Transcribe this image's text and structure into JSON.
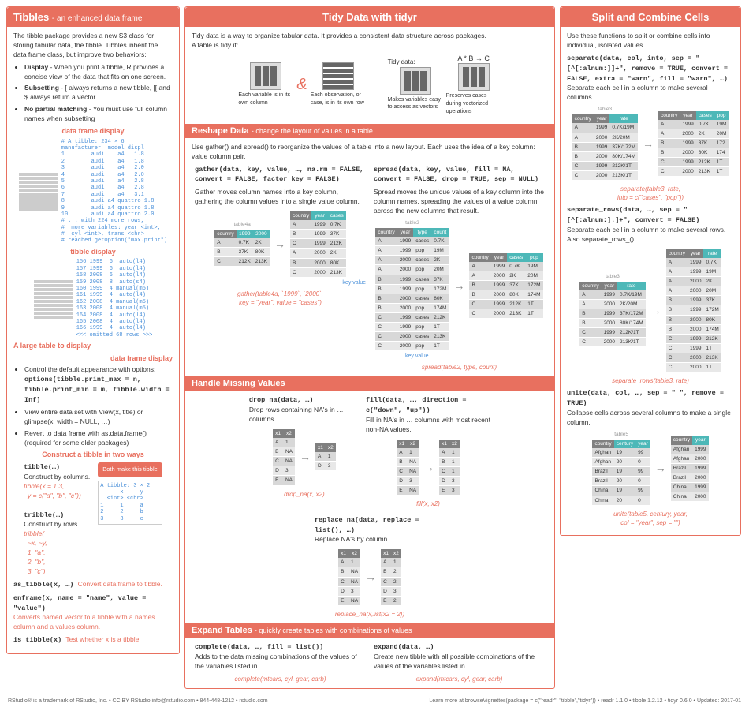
{
  "left": {
    "title": "Tibbles",
    "subtitle": "- an enhanced data frame",
    "intro": "The tibble package provides a new S3 class for storing tabular data, the tibble. Tibbles inherit the data frame class, but improve two behaviors:",
    "bullets": [
      {
        "b": "Display",
        "t": " - When you print a tibble, R provides a concise view of the data that fits on one screen."
      },
      {
        "b": "Subsetting",
        "t": " - [ always returns a new tibble, [[ and $ always return a vector."
      },
      {
        "b": "No partial matching",
        "t": " - You must use full column names when subsetting"
      }
    ],
    "dflabel": "data frame display",
    "tiblabel": "tibble display",
    "largelbl": "A large table\nto display",
    "control": "Control the default appearance with options:",
    "options": "options(tibble.print_max = n, tibble.print_min = m, tibble.width = Inf)",
    "view": "View entire data set with View(x, title) or glimpse(x, width = NULL, …)",
    "revert": "Revert to data frame with as.data.frame() (required for some older packages)",
    "construct": "Construct a tibble in two ways",
    "tibble_fn": "tibble(…)",
    "tibble_desc": "Construct by columns.",
    "tibble_ex": "tibble(x = 1:3,\n  y = c(\"a\", \"b\", \"c\"))",
    "tribble_fn": "tribble(…)",
    "tribble_desc": "Construct by rows.",
    "tribble_ex": "tribble(\n  ~x, ~y,\n  1, \"a\",\n  2, \"b\",\n  3, \"c\")",
    "badge": "Both make this tibble",
    "tblout": "A tibble: 3 × 2\n      x     y\n  <int> <chr>\n1     1     a\n2     2     b\n3     3     c",
    "as_tibble": "as_tibble(x, …) ",
    "as_tibble_d": "Convert data frame to tibble.",
    "enframe": "enframe(x, name = \"name\", value = \"value\")",
    "enframe_d": "Converts named vector to a tibble with a names column and a values column.",
    "is_tibble": "is_tibble(x) ",
    "is_tibble_d": "Test whether x is a tibble."
  },
  "mid": {
    "title": "Tidy Data with tidyr",
    "intro": "Tidy data is a way to organize tabular data. It provides a consistent data structure across packages.\nA table is tidy if:",
    "tidydata": "Tidy data:",
    "formula": "A  *  B  →  C",
    "icon1": "Each variable is in its own column",
    "icon2": "Each observation, or case, is in its own row",
    "icon3": "Makes variables easy to access as vectors",
    "icon4": "Preserves cases during vectorized operations",
    "reshape": "Reshape Data",
    "reshape_sub": "- change the layout of values in a table",
    "reshape_intro": "Use gather() and spread() to reorganize the values of a table into a new layout. Each uses the idea of a key column: value column pair.",
    "gather_sig": "gather(data, key, value, …, na.rm = FALSE, convert = FALSE, factor_key = FALSE)",
    "gather_desc": "Gather moves column names into a key column, gathering the column values into a single value column.",
    "gather_call": "gather(table4a, `1999`, `2000`,\nkey = \"year\", value = \"cases\")",
    "spread_sig": "spread(data, key, value, fill = NA, convert = FALSE, drop = TRUE, sep = NULL)",
    "spread_desc": "Spread moves the unique values of a key column into the column names, spreading the values of a value column across the new columns that result.",
    "spread_call": "spread(table2, type, count)",
    "kv": "key   value",
    "missing": "Handle Missing Values",
    "dropna": "drop_na(data, …)",
    "dropna_d": "Drop rows containing NA's in … columns.",
    "dropna_c": "drop_na(x, x2)",
    "fill": "fill(data, …, direction = c(\"down\", \"up\"))",
    "fill_d": "Fill in NA's in … columns with most recent non-NA values.",
    "fill_c": "fill(x, x2)",
    "replace": "replace_na(data, replace = list(), …)",
    "replace_d": "Replace NA's by column.",
    "replace_c": "replace_na(x,list(x2 = 2))",
    "expand": "Expand Tables",
    "expand_sub": "- quickly create tables with  combinations of values",
    "complete": "complete(data, …, fill = list())",
    "complete_d": "Adds to the data missing combinations of the values of the variables listed in …",
    "complete_c": "complete(mtcars, cyl, gear, carb)",
    "expand_fn": "expand(data, …)",
    "expand_d": "Create new tibble with all possible combinations of the values of the variables listed in …",
    "expand_c": "expand(mtcars, cyl, gear, carb)"
  },
  "right": {
    "title": "Split and Combine Cells",
    "intro": "Use these functions to split or combine cells into individual, isolated values.",
    "separate": "separate(data, col, into, sep = \"[^[:alnum:]]+\", remove = TRUE, convert = FALSE, extra = \"warn\", fill = \"warn\", …)",
    "separate_d": "Separate each cell in a column to make several columns.",
    "sep_call": "separate(table3, rate,\ninto = c(\"cases\", \"pop\"))",
    "separate_rows": "separate_rows(data, …, sep = \"[^[:alnum:].]+\", convert = FALSE)",
    "separate_rows_d": "Separate each cell in a column to make several rows. Also separate_rows_().",
    "seprows_call": "separate_rows(table3, rate)",
    "unite": "unite(data, col, …, sep = \"_\", remove = TRUE)",
    "unite_d": "Collapse cells across several columns to make a single column.",
    "unite_call": "unite(table5, century, year,\ncol = \"year\", sep = \"\")"
  },
  "tables": {
    "table4a": {
      "label": "table4a",
      "head": [
        "country",
        "1999",
        "2000"
      ],
      "rows": [
        [
          "A",
          "0.7K",
          "2K"
        ],
        [
          "B",
          "37K",
          "80K"
        ],
        [
          "C",
          "212K",
          "213K"
        ]
      ]
    },
    "gathered": {
      "head": [
        "country",
        "year",
        "cases"
      ],
      "rows": [
        [
          "A",
          "1999",
          "0.7K"
        ],
        [
          "B",
          "1999",
          "37K"
        ],
        [
          "C",
          "1999",
          "212K"
        ],
        [
          "A",
          "2000",
          "2K"
        ],
        [
          "B",
          "2000",
          "80K"
        ],
        [
          "C",
          "2000",
          "213K"
        ]
      ]
    },
    "table2": {
      "label": "table2",
      "head": [
        "country",
        "year",
        "type",
        "count"
      ],
      "rows": [
        [
          "A",
          "1999",
          "cases",
          "0.7K"
        ],
        [
          "A",
          "1999",
          "pop",
          "19M"
        ],
        [
          "A",
          "2000",
          "cases",
          "2K"
        ],
        [
          "A",
          "2000",
          "pop",
          "20M"
        ],
        [
          "B",
          "1999",
          "cases",
          "37K"
        ],
        [
          "B",
          "1999",
          "pop",
          "172M"
        ],
        [
          "B",
          "2000",
          "cases",
          "80K"
        ],
        [
          "B",
          "2000",
          "pop",
          "174M"
        ],
        [
          "C",
          "1999",
          "cases",
          "212K"
        ],
        [
          "C",
          "1999",
          "pop",
          "1T"
        ],
        [
          "C",
          "2000",
          "cases",
          "213K"
        ],
        [
          "C",
          "2000",
          "pop",
          "1T"
        ]
      ]
    },
    "spread_out": {
      "head": [
        "country",
        "year",
        "cases",
        "pop"
      ],
      "rows": [
        [
          "A",
          "1999",
          "0.7K",
          "19M"
        ],
        [
          "A",
          "2000",
          "2K",
          "20M"
        ],
        [
          "B",
          "1999",
          "37K",
          "172M"
        ],
        [
          "B",
          "2000",
          "80K",
          "174M"
        ],
        [
          "C",
          "1999",
          "212K",
          "1T"
        ],
        [
          "C",
          "2000",
          "213K",
          "1T"
        ]
      ]
    },
    "table3": {
      "label": "table3",
      "head": [
        "country",
        "year",
        "rate"
      ],
      "rows": [
        [
          "A",
          "1999",
          "0.7K/19M"
        ],
        [
          "A",
          "2000",
          "2K/20M"
        ],
        [
          "B",
          "1999",
          "37K/172M"
        ],
        [
          "B",
          "2000",
          "80K/174M"
        ],
        [
          "C",
          "1999",
          "212K/1T"
        ],
        [
          "C",
          "2000",
          "213K/1T"
        ]
      ]
    },
    "sep_out": {
      "head": [
        "country",
        "year",
        "cases",
        "pop"
      ],
      "rows": [
        [
          "A",
          "1999",
          "0.7K",
          "19M"
        ],
        [
          "A",
          "2000",
          "2K",
          "20M"
        ],
        [
          "B",
          "1999",
          "37K",
          "172"
        ],
        [
          "B",
          "2000",
          "80K",
          "174"
        ],
        [
          "C",
          "1999",
          "212K",
          "1T"
        ],
        [
          "C",
          "2000",
          "213K",
          "1T"
        ]
      ]
    },
    "seprows_out": {
      "head": [
        "country",
        "year",
        "rate"
      ],
      "rows": [
        [
          "A",
          "1999",
          "0.7K"
        ],
        [
          "A",
          "1999",
          "19M"
        ],
        [
          "A",
          "2000",
          "2K"
        ],
        [
          "A",
          "2000",
          "20M"
        ],
        [
          "B",
          "1999",
          "37K"
        ],
        [
          "B",
          "1999",
          "172M"
        ],
        [
          "B",
          "2000",
          "80K"
        ],
        [
          "B",
          "2000",
          "174M"
        ],
        [
          "C",
          "1999",
          "212K"
        ],
        [
          "C",
          "1999",
          "1T"
        ],
        [
          "C",
          "2000",
          "213K"
        ],
        [
          "C",
          "2000",
          "1T"
        ]
      ]
    },
    "table5": {
      "label": "table5",
      "head": [
        "country",
        "century",
        "year"
      ],
      "rows": [
        [
          "Afghan",
          "19",
          "99"
        ],
        [
          "Afghan",
          "20",
          "0"
        ],
        [
          "Brazil",
          "19",
          "99"
        ],
        [
          "Brazil",
          "20",
          "0"
        ],
        [
          "China",
          "19",
          "99"
        ],
        [
          "China",
          "20",
          "0"
        ]
      ]
    },
    "unite_out": {
      "head": [
        "country",
        "year"
      ],
      "rows": [
        [
          "Afghan",
          "1999"
        ],
        [
          "Afghan",
          "2000"
        ],
        [
          "Brazil",
          "1999"
        ],
        [
          "Brazil",
          "2000"
        ],
        [
          "China",
          "1999"
        ],
        [
          "China",
          "2000"
        ]
      ]
    },
    "na_in": {
      "head": [
        "x1",
        "x2"
      ],
      "rows": [
        [
          "A",
          "1"
        ],
        [
          "B",
          "NA"
        ],
        [
          "C",
          "NA"
        ],
        [
          "D",
          "3"
        ],
        [
          "E",
          "NA"
        ]
      ]
    },
    "dropna_out": {
      "head": [
        "x1",
        "x2"
      ],
      "rows": [
        [
          "A",
          "1"
        ],
        [
          "D",
          "3"
        ]
      ]
    },
    "fill_out": {
      "head": [
        "x1",
        "x2"
      ],
      "rows": [
        [
          "A",
          "1"
        ],
        [
          "B",
          "1"
        ],
        [
          "C",
          "1"
        ],
        [
          "D",
          "3"
        ],
        [
          "E",
          "3"
        ]
      ]
    },
    "replace_out": {
      "head": [
        "x1",
        "x2"
      ],
      "rows": [
        [
          "A",
          "1"
        ],
        [
          "B",
          "2"
        ],
        [
          "C",
          "2"
        ],
        [
          "D",
          "3"
        ],
        [
          "E",
          "2"
        ]
      ]
    }
  },
  "footer": {
    "left": "RStudio® is a trademark of RStudio, Inc. • CC BY  RStudio info@rstudio.com • 844-448-1212 • rstudio.com",
    "right": "Learn more at browseVignettes(package = c(\"readr\", \"tibble\",\"tidyr\")) • readr 1.1.0 •  tibble 1.2.12 •  tidyr  0.6.0 •  Updated: 2017-01"
  }
}
